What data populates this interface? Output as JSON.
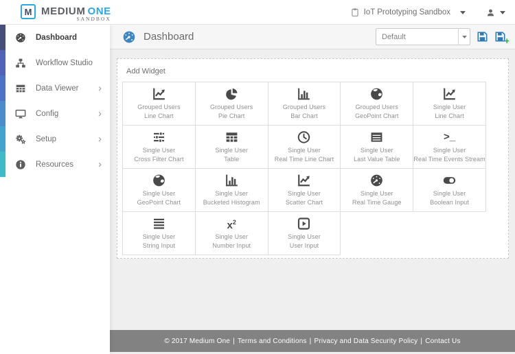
{
  "brand": {
    "mark": "M",
    "name_primary": "MEDIUM",
    "name_accent": "ONE",
    "subtitle": "SANDBOX"
  },
  "top_bar": {
    "workspace_label": "IoT Prototyping Sandbox"
  },
  "sidebar": {
    "items": [
      {
        "label": "Dashboard",
        "icon": "dashboard-gauge-icon",
        "active": true,
        "has_submenu": false
      },
      {
        "label": "Workflow Studio",
        "icon": "workflow-sitemap-icon",
        "active": false,
        "has_submenu": false
      },
      {
        "label": "Data Viewer",
        "icon": "data-table-icon",
        "active": false,
        "has_submenu": true
      },
      {
        "label": "Config",
        "icon": "desktop-icon",
        "active": false,
        "has_submenu": true
      },
      {
        "label": "Setup",
        "icon": "gears-icon",
        "active": false,
        "has_submenu": true
      },
      {
        "label": "Resources",
        "icon": "info-circle-icon",
        "active": false,
        "has_submenu": true
      }
    ]
  },
  "content_header": {
    "title": "Dashboard",
    "dashboard_select": {
      "value": "Default"
    }
  },
  "add_widget": {
    "title": "Add Widget",
    "tiles": [
      {
        "line1": "Grouped Users",
        "line2": "Line Chart",
        "icon": "line-chart-icon"
      },
      {
        "line1": "Grouped Users",
        "line2": "Pie Chart",
        "icon": "pie-chart-icon"
      },
      {
        "line1": "Grouped Users",
        "line2": "Bar Chart",
        "icon": "bar-chart-icon"
      },
      {
        "line1": "Grouped Users",
        "line2": "GeoPoint Chart",
        "icon": "globe-icon"
      },
      {
        "line1": "Single User",
        "line2": "Line Chart",
        "icon": "line-chart-icon"
      },
      {
        "line1": "Single User",
        "line2": "Cross Filter Chart",
        "icon": "sliders-icon"
      },
      {
        "line1": "Single User",
        "line2": "Table",
        "icon": "table-icon"
      },
      {
        "line1": "Single User",
        "line2": "Real Time Line Chart",
        "icon": "clock-icon"
      },
      {
        "line1": "Single User",
        "line2": "Last Value Table",
        "icon": "list-table-icon"
      },
      {
        "line1": "Single User",
        "line2": "Real Time Events Stream",
        "icon": "terminal-icon"
      },
      {
        "line1": "Single User",
        "line2": "GeoPoint Chart",
        "icon": "globe-icon"
      },
      {
        "line1": "Single User",
        "line2": "Bucketed Histogram",
        "icon": "bar-chart-icon"
      },
      {
        "line1": "Single User",
        "line2": "Scatter Chart",
        "icon": "line-chart-icon"
      },
      {
        "line1": "Single User",
        "line2": "Real Time Gauge",
        "icon": "dashboard-gauge-icon"
      },
      {
        "line1": "Single User",
        "line2": "Boolean Input",
        "icon": "toggle-icon"
      },
      {
        "line1": "Single User",
        "line2": "String Input",
        "icon": "string-lines-icon"
      },
      {
        "line1": "Single User",
        "line2": "Number Input",
        "icon": "number-squared-icon"
      },
      {
        "line1": "Single User",
        "line2": "User Input",
        "icon": "play-square-icon"
      }
    ]
  },
  "footer": {
    "copyright": "© 2017 Medium One",
    "separator": "|",
    "links": [
      "Terms and Conditions",
      "Privacy and Data Security Policy",
      "Contact Us"
    ]
  },
  "colors": {
    "accent_blue": "#2ba8df",
    "header_icon_blue": "#3d86c6",
    "save_icon_blue": "#2e7cb5",
    "plus_green": "#3aa545",
    "footer_bg": "#828282",
    "strip": [
      "#454f79",
      "#5263b5",
      "#4d74c4",
      "#4a8ccc",
      "#44a3cd",
      "#3fbac6"
    ]
  }
}
